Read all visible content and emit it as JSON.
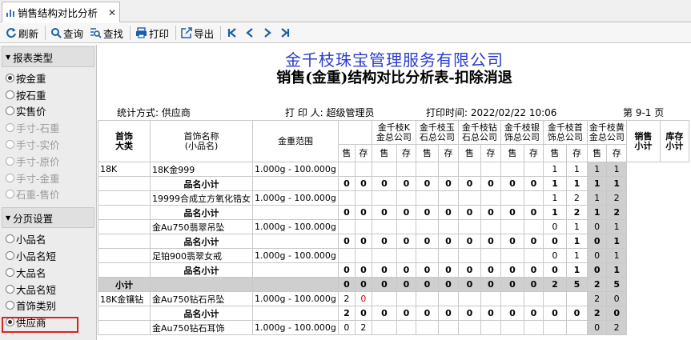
{
  "tab": {
    "title": "销售结构对比分析"
  },
  "toolbar": {
    "refresh": "刷新",
    "query": "查询",
    "find": "查找",
    "print": "打印",
    "export": "导出"
  },
  "sidebar": {
    "section1": "报表类型",
    "report_types": [
      {
        "label": "按金重",
        "selected": true,
        "disabled": false
      },
      {
        "label": "按石重",
        "selected": false,
        "disabled": false
      },
      {
        "label": "实售价",
        "selected": false,
        "disabled": false
      },
      {
        "label": "手寸-石重",
        "selected": false,
        "disabled": true
      },
      {
        "label": "手寸-实价",
        "selected": false,
        "disabled": true
      },
      {
        "label": "手寸-原价",
        "selected": false,
        "disabled": true
      },
      {
        "label": "手寸-金重",
        "selected": false,
        "disabled": true
      },
      {
        "label": "石重-售价",
        "selected": false,
        "disabled": true
      }
    ],
    "section2": "分页设置",
    "page_settings": [
      {
        "label": "小品名",
        "selected": false
      },
      {
        "label": "小品名短",
        "selected": false
      },
      {
        "label": "大品名",
        "selected": false
      },
      {
        "label": "大品名短",
        "selected": false
      },
      {
        "label": "首饰类别",
        "selected": false
      },
      {
        "label": "供应商",
        "selected": true
      }
    ]
  },
  "report": {
    "company": "金千枝珠宝管理服务有限公司",
    "title": "销售(金重)结构对比分析表-扣除消退",
    "stat_method": "统计方式: 供应商",
    "printer": "打 印 人: 超级管理员",
    "print_time": "打印时间: 2022/02/22 10:06",
    "page": "第 9-1 页",
    "headers": {
      "category": "首饰\n大类",
      "name": "首饰名称\n(小品名)",
      "range": "金重范围",
      "stores": [
        "金千枝K\n金总公司",
        "金千枝玉\n石总公司",
        "金千枝钻\n石总公司",
        "金千枝银\n饰总公司",
        "金千枝首\n饰总公司",
        "金千枝黄\n金总公司"
      ],
      "sale_total": "销售\n小计",
      "stock_total": "库存\n小计",
      "sale": "售",
      "stock": "存"
    },
    "rows": [
      {
        "type": "item",
        "cat": "18K",
        "name": "18K金999",
        "range": "1.000g - 100.000g",
        "vals": [
          "",
          "",
          "",
          "",
          "",
          "",
          "",
          "",
          "",
          "",
          "1",
          "1"
        ],
        "st": "1",
        "kt": "1"
      },
      {
        "type": "sub",
        "cat": "",
        "name": "品名小计",
        "range": "",
        "vals": [
          "0",
          "0",
          "0",
          "0",
          "0",
          "0",
          "0",
          "0",
          "0",
          "0",
          "1",
          "1"
        ],
        "st": "1",
        "kt": "1"
      },
      {
        "type": "item",
        "cat": "",
        "name": "19999合成立方氧化锆女",
        "range": "1.000g - 100.000g",
        "vals": [
          "",
          "",
          "",
          "",
          "",
          "",
          "",
          "",
          "",
          "",
          "1",
          "2"
        ],
        "st": "1",
        "kt": "2"
      },
      {
        "type": "sub",
        "cat": "",
        "name": "品名小计",
        "range": "",
        "vals": [
          "0",
          "0",
          "0",
          "0",
          "0",
          "0",
          "0",
          "0",
          "0",
          "0",
          "1",
          "2"
        ],
        "st": "1",
        "kt": "2"
      },
      {
        "type": "item",
        "cat": "",
        "name": "金Au750翡翠吊坠",
        "range": "1.000g - 100.000g",
        "vals": [
          "",
          "",
          "",
          "",
          "",
          "",
          "",
          "",
          "",
          "",
          "0",
          "1"
        ],
        "st": "0",
        "kt": "1"
      },
      {
        "type": "sub",
        "cat": "",
        "name": "品名小计",
        "range": "",
        "vals": [
          "0",
          "0",
          "0",
          "0",
          "0",
          "0",
          "0",
          "0",
          "0",
          "0",
          "0",
          "1"
        ],
        "st": "0",
        "kt": "1"
      },
      {
        "type": "item",
        "cat": "",
        "name": "足铂900翡翠女戒",
        "range": "1.000g - 100.000g",
        "vals": [
          "",
          "",
          "",
          "",
          "",
          "",
          "",
          "",
          "",
          "",
          "0",
          "1"
        ],
        "st": "0",
        "kt": "1"
      },
      {
        "type": "sub",
        "cat": "",
        "name": "品名小计",
        "range": "",
        "vals": [
          "0",
          "0",
          "0",
          "0",
          "0",
          "0",
          "0",
          "0",
          "0",
          "0",
          "0",
          "1"
        ],
        "st": "0",
        "kt": "1"
      },
      {
        "type": "total",
        "cat": "小计",
        "name": "",
        "range": "",
        "vals": [
          "0",
          "0",
          "0",
          "0",
          "0",
          "0",
          "0",
          "0",
          "0",
          "0",
          "2",
          "5"
        ],
        "st": "2",
        "kt": "5"
      },
      {
        "type": "item",
        "cat": "18K金镶钻",
        "name": "金Au750钻石吊坠",
        "range": "1.000g - 100.000g",
        "vals": [
          "2",
          "0",
          "",
          "",
          "",
          "",
          "",
          "",
          "",
          "",
          "",
          ""
        ],
        "st": "2",
        "kt": "0",
        "red": [
          1
        ]
      },
      {
        "type": "sub",
        "cat": "",
        "name": "品名小计",
        "range": "",
        "vals": [
          "2",
          "0",
          "0",
          "0",
          "0",
          "0",
          "0",
          "0",
          "0",
          "0",
          "0",
          "0"
        ],
        "st": "2",
        "kt": "0"
      },
      {
        "type": "item",
        "cat": "",
        "name": "金Au750钻石耳饰",
        "range": "1.000g - 100.000g",
        "vals": [
          "0",
          "2",
          "",
          "",
          "",
          "",
          "",
          "",
          "",
          "",
          "",
          ""
        ],
        "st": "0",
        "kt": "2"
      }
    ]
  },
  "colors": {
    "company": "#2a3ccc",
    "highlight": "#e02020",
    "red_value": "#e00000"
  }
}
